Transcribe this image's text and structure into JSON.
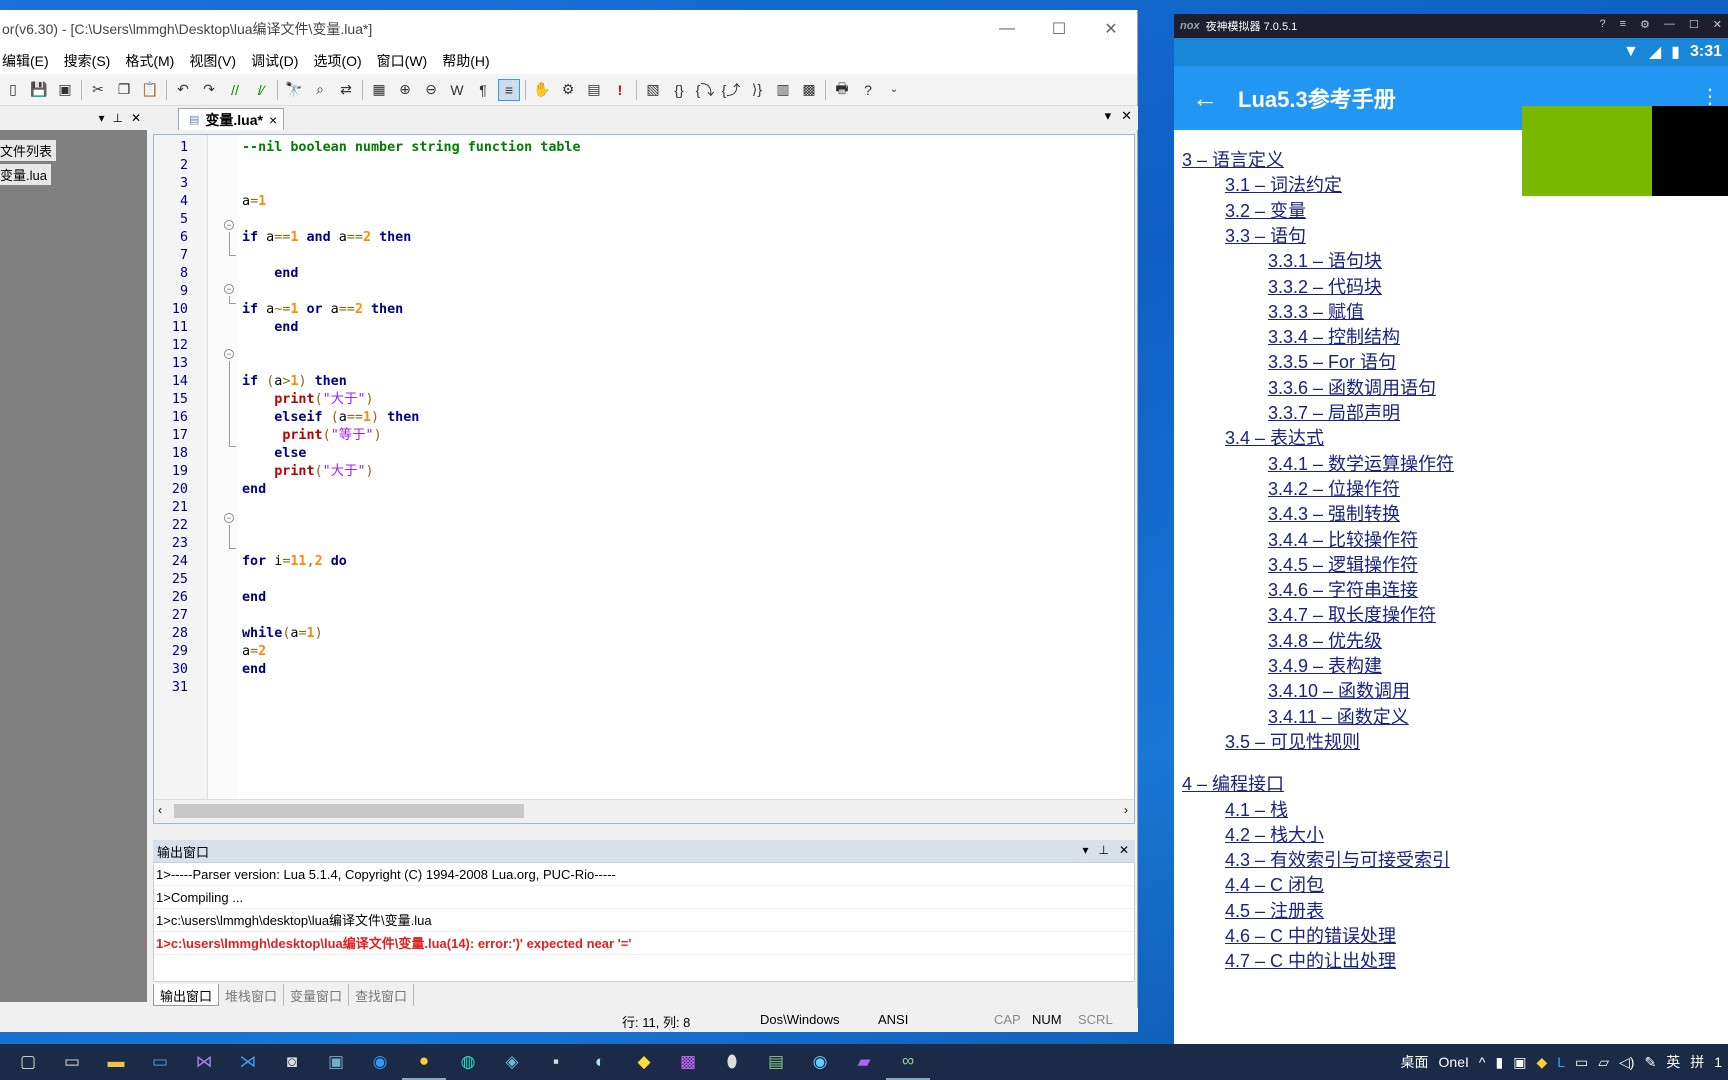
{
  "editor": {
    "title": "or(v6.30) - [C:\\Users\\lmmgh\\Desktop\\lua编译文件\\变量.lua*]",
    "menu": [
      "编辑(E)",
      "搜索(S)",
      "格式(M)",
      "视图(V)",
      "调试(D)",
      "选项(O)",
      "窗口(W)",
      "帮助(H)"
    ],
    "tree": {
      "root": "文件列表",
      "file": "变量.lua"
    },
    "tab_label": "变量.lua*",
    "tab_close": "×",
    "code_lines": [
      {
        "n": "1",
        "html": "<span class='cm'>--nil boolean number string function table</span>"
      },
      {
        "n": "2",
        "html": ""
      },
      {
        "n": "3",
        "html": ""
      },
      {
        "n": "4",
        "html": "a<span class='op'>=</span><span class='num'>1</span>"
      },
      {
        "n": "5",
        "html": ""
      },
      {
        "n": "6",
        "html": "<span class='kw'>if</span> a<span class='op'>==</span><span class='num'>1</span> <span class='kw'>and</span> a<span class='op'>==</span><span class='num'>2</span> <span class='kw'>then</span>"
      },
      {
        "n": "7",
        "html": ""
      },
      {
        "n": "8",
        "html": "    <span class='kw'>end</span>"
      },
      {
        "n": "9",
        "html": ""
      },
      {
        "n": "10",
        "html": "<span class='kw'>if</span> a<span class='op'>~=</span><span class='num'>1</span> <span class='kw'>or</span> a<span class='op'>==</span><span class='num'>2</span> <span class='kw'>then</span>"
      },
      {
        "n": "11",
        "html": "    <span class='kw'>end</span>"
      },
      {
        "n": "12",
        "html": ""
      },
      {
        "n": "13",
        "html": ""
      },
      {
        "n": "14",
        "html": "<span class='kw'>if</span> <span class='op'>(</span>a<span class='op'>&gt;</span><span class='num'>1</span><span class='op'>)</span> <span class='kw'>then</span>"
      },
      {
        "n": "15",
        "html": "    <span class='fn'>print</span><span class='op'>(</span><span class='str'>\"大于\"</span><span class='op'>)</span>"
      },
      {
        "n": "16",
        "html": "    <span class='kw'>elseif</span> <span class='op'>(</span>a<span class='op'>==</span><span class='num'>1</span><span class='op'>)</span> <span class='kw'>then</span>"
      },
      {
        "n": "17",
        "html": "     <span class='fn'>print</span><span class='op'>(</span><span class='str'>\"等于\"</span><span class='op'>)</span>"
      },
      {
        "n": "18",
        "html": "    <span class='kw'>else</span>"
      },
      {
        "n": "19",
        "html": "    <span class='fn'>print</span><span class='op'>(</span><span class='str'>\"大于\"</span><span class='op'>)</span>"
      },
      {
        "n": "20",
        "html": "<span class='kw'>end</span>"
      },
      {
        "n": "21",
        "html": ""
      },
      {
        "n": "22",
        "html": ""
      },
      {
        "n": "23",
        "html": ""
      },
      {
        "n": "24",
        "html": "<span class='kw'>for</span> i<span class='op'>=</span><span class='num'>11</span><span class='op'>,</span><span class='num'>2</span> <span class='kw'>do</span>"
      },
      {
        "n": "25",
        "html": ""
      },
      {
        "n": "26",
        "html": "<span class='kw'>end</span>"
      },
      {
        "n": "27",
        "html": ""
      },
      {
        "n": "28",
        "html": "<span class='kw'>while</span><span class='op'>(</span>a<span class='op'>=</span><span class='num'>1</span><span class='op'>)</span>"
      },
      {
        "n": "29",
        "html": "a<span class='op'>=</span><span class='num'>2</span>"
      },
      {
        "n": "30",
        "html": "<span class='kw'>end</span>"
      },
      {
        "n": "31",
        "html": ""
      }
    ],
    "output_title": "输出窗口",
    "output_lines": [
      "1>-----Parser version: Lua 5.1.4, Copyright (C) 1994-2008 Lua.org, PUC-Rio-----",
      "1>Compiling ...",
      "1>c:\\users\\lmmgh\\desktop\\lua编译文件\\变量.lua",
      "1>c:\\users\\lmmgh\\desktop\\lua编译文件\\变量.lua(14): error:')' expected near '='"
    ],
    "output_tabs": [
      "输出窗口",
      "堆栈窗口",
      "变量窗口",
      "查找窗口"
    ],
    "status": {
      "pos": "行: 11, 列: 8",
      "eol": "Dos\\Windows",
      "enc": "ANSI",
      "cap": "CAP",
      "num": "NUM",
      "scrl": "SCRL"
    }
  },
  "emulator": {
    "title": "夜神模拟器 7.0.5.1",
    "logo": "nox",
    "clock": "3:31",
    "app_title": "Lua5.3参考手册",
    "toc": [
      {
        "level": 0,
        "text": "3 – 语言定义"
      },
      {
        "level": 1,
        "text": "3.1 – 词法约定"
      },
      {
        "level": 1,
        "text": "3.2 – 变量"
      },
      {
        "level": 1,
        "text": "3.3 – 语句"
      },
      {
        "level": 2,
        "text": "3.3.1 – 语句块"
      },
      {
        "level": 2,
        "text": "3.3.2 – 代码块"
      },
      {
        "level": 2,
        "text": "3.3.3 – 赋值"
      },
      {
        "level": 2,
        "text": "3.3.4 – 控制结构"
      },
      {
        "level": 2,
        "text": "3.3.5 – For 语句"
      },
      {
        "level": 2,
        "text": "3.3.6 – 函数调用语句"
      },
      {
        "level": 2,
        "text": "3.3.7 – 局部声明"
      },
      {
        "level": 1,
        "text": "3.4 – 表达式"
      },
      {
        "level": 2,
        "text": "3.4.1 – 数学运算操作符"
      },
      {
        "level": 2,
        "text": "3.4.2 – 位操作符"
      },
      {
        "level": 2,
        "text": "3.4.3 – 强制转换"
      },
      {
        "level": 2,
        "text": "3.4.4 – 比较操作符"
      },
      {
        "level": 2,
        "text": "3.4.5 – 逻辑操作符"
      },
      {
        "level": 2,
        "text": "3.4.6 – 字符串连接"
      },
      {
        "level": 2,
        "text": "3.4.7 – 取长度操作符"
      },
      {
        "level": 2,
        "text": "3.4.8 – 优先级"
      },
      {
        "level": 2,
        "text": "3.4.9 – 表构建"
      },
      {
        "level": 2,
        "text": "3.4.10 – 函数调用"
      },
      {
        "level": 2,
        "text": "3.4.11 – 函数定义"
      },
      {
        "level": 1,
        "text": "3.5 – 可见性规则"
      },
      {
        "level": 0,
        "text": "4 – 编程接口",
        "gap": true
      },
      {
        "level": 1,
        "text": "4.1 – 栈"
      },
      {
        "level": 1,
        "text": "4.2 – 栈大小"
      },
      {
        "level": 1,
        "text": "4.3 – 有效索引与可接受索引"
      },
      {
        "level": 1,
        "text": "4.4 – C 闭包"
      },
      {
        "level": 1,
        "text": "4.5 – 注册表"
      },
      {
        "level": 1,
        "text": "4.6 – C 中的错误处理"
      },
      {
        "level": 1,
        "text": "4.7 – C 中的让出处理"
      }
    ]
  },
  "taskbar": {
    "tray_desktop": "桌面",
    "tray_onedrive": "OneI",
    "tray_lang": "英",
    "tray_ime": "拼",
    "tray_end": "1"
  }
}
